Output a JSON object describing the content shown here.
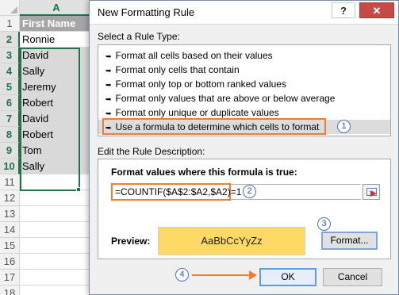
{
  "sheet": {
    "column_header": "A",
    "row_numbers": [
      "1",
      "2",
      "3",
      "4",
      "5",
      "6",
      "7",
      "8",
      "9",
      "10",
      "11",
      "12",
      "13",
      "14",
      "15",
      "16",
      "17",
      "18"
    ],
    "header_cell": "First Name",
    "names": [
      "Ronnie",
      "David",
      "Sally",
      "Jeremy",
      "Robert",
      "David",
      "Robert",
      "Tom",
      "Sally"
    ]
  },
  "dialog": {
    "title": "New Formatting Rule",
    "help_glyph": "?",
    "close_glyph": "✕",
    "select_rule_type_label": "Select a Rule Type:",
    "rule_types": [
      "Format all cells based on their values",
      "Format only cells that contain",
      "Format only top or bottom ranked values",
      "Format only values that are above or below average",
      "Format only unique or duplicate values",
      "Use a formula to determine which cells to format"
    ],
    "rule_arrow": "➥",
    "edit_description_label": "Edit the Rule Description:",
    "formula_label": "Format values where this formula is true:",
    "formula_value": "=COUNTIF($A$2:$A2,$A2)=1",
    "preview_label": "Preview:",
    "preview_text": "AaBbCcYyZz",
    "format_button": "Format...",
    "ok_button": "OK",
    "cancel_button": "Cancel"
  },
  "callouts": [
    "1",
    "2",
    "3",
    "4"
  ],
  "colors": {
    "accent_orange": "#ed7d31",
    "callout_blue": "#4472c4",
    "preview_fill": "#ffd966",
    "excel_green": "#217346"
  }
}
